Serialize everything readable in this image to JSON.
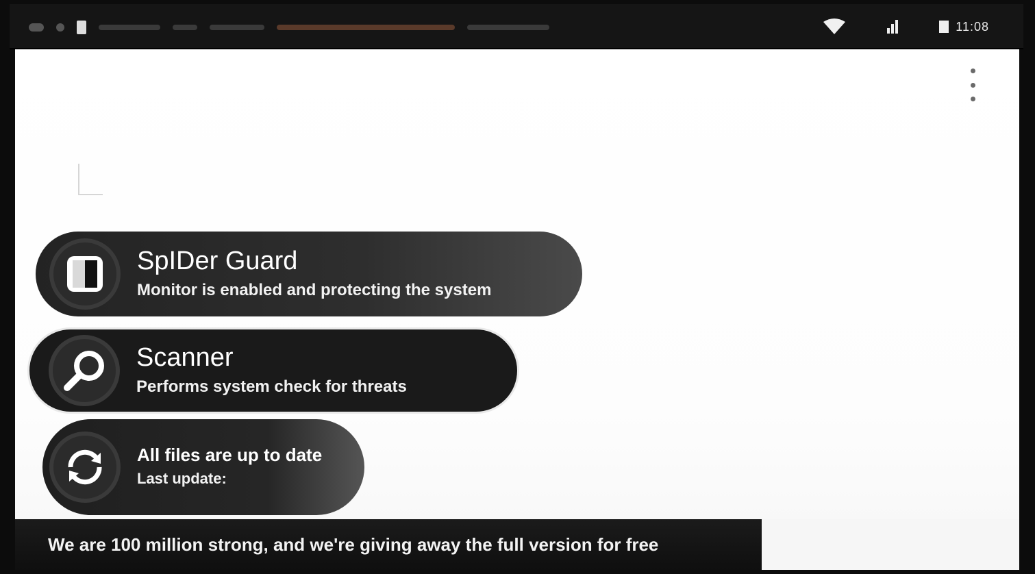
{
  "statusbar": {
    "time": "11:08",
    "icons": [
      "sd-card-icon",
      "wifi-icon",
      "signal-icon",
      "battery-icon"
    ]
  },
  "header": {
    "title": "",
    "subtitle": ""
  },
  "items": [
    {
      "name": "spider-guard",
      "icon": "shield-icon",
      "title": "SpIDer Guard",
      "subtitle": "Monitor is enabled and protecting the system"
    },
    {
      "name": "scanner",
      "icon": "search-icon",
      "title": "Scanner",
      "subtitle": "Performs system check for threats"
    },
    {
      "name": "update",
      "icon": "refresh-icon",
      "title": "All files are up to date",
      "subtitle": "Last update:"
    }
  ],
  "footer": {
    "banner_text": "We are 100 million strong, and we're giving away the full version for free"
  },
  "colors": {
    "item_background": "#1b1b1b",
    "app_background": "#ffffff",
    "statusbar_background": "#151515"
  }
}
